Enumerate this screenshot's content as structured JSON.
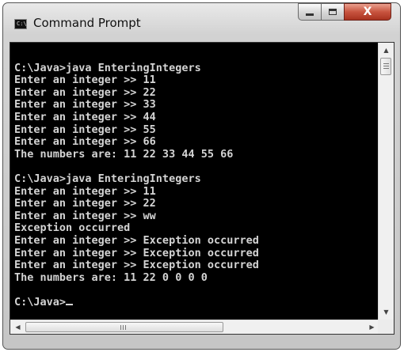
{
  "window": {
    "title": "Command Prompt"
  },
  "icons": {
    "app": "cmd-icon",
    "minimize": "minimize-icon",
    "maximize": "maximize-icon",
    "close": "close-icon",
    "scroll_up": "arrow-up-icon",
    "scroll_down": "arrow-down-icon",
    "scroll_left": "arrow-left-icon",
    "scroll_right": "arrow-right-icon"
  },
  "app_icon": {
    "glyph": "C:\\"
  },
  "controls": {
    "close_glyph": "X"
  },
  "console": {
    "lines": [
      "",
      "C:\\Java>java EnteringIntegers",
      "Enter an integer >> 11",
      "Enter an integer >> 22",
      "Enter an integer >> 33",
      "Enter an integer >> 44",
      "Enter an integer >> 55",
      "Enter an integer >> 66",
      "The numbers are: 11 22 33 44 55 66",
      "",
      "C:\\Java>java EnteringIntegers",
      "Enter an integer >> 11",
      "Enter an integer >> 22",
      "Enter an integer >> ww",
      "Exception occurred",
      "Enter an integer >> Exception occurred",
      "Enter an integer >> Exception occurred",
      "Enter an integer >> Exception occurred",
      "The numbers are: 11 22 0 0 0 0",
      "",
      "C:\\Java>"
    ]
  },
  "colors": {
    "console_background": "#000000",
    "console_text": "#d4d4d4",
    "close_button": "#c8543f"
  }
}
